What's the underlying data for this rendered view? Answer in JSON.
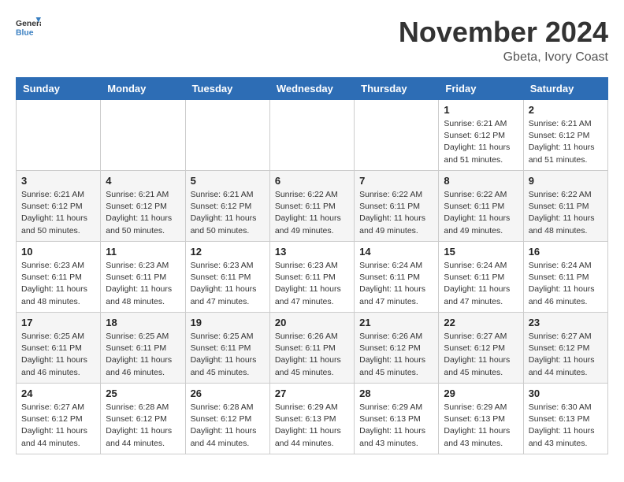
{
  "header": {
    "logo_general": "General",
    "logo_blue": "Blue",
    "month_title": "November 2024",
    "location": "Gbeta, Ivory Coast"
  },
  "days_of_week": [
    "Sunday",
    "Monday",
    "Tuesday",
    "Wednesday",
    "Thursday",
    "Friday",
    "Saturday"
  ],
  "weeks": [
    [
      {
        "day": "",
        "info": ""
      },
      {
        "day": "",
        "info": ""
      },
      {
        "day": "",
        "info": ""
      },
      {
        "day": "",
        "info": ""
      },
      {
        "day": "",
        "info": ""
      },
      {
        "day": "1",
        "info": "Sunrise: 6:21 AM\nSunset: 6:12 PM\nDaylight: 11 hours\nand 51 minutes."
      },
      {
        "day": "2",
        "info": "Sunrise: 6:21 AM\nSunset: 6:12 PM\nDaylight: 11 hours\nand 51 minutes."
      }
    ],
    [
      {
        "day": "3",
        "info": "Sunrise: 6:21 AM\nSunset: 6:12 PM\nDaylight: 11 hours\nand 50 minutes."
      },
      {
        "day": "4",
        "info": "Sunrise: 6:21 AM\nSunset: 6:12 PM\nDaylight: 11 hours\nand 50 minutes."
      },
      {
        "day": "5",
        "info": "Sunrise: 6:21 AM\nSunset: 6:12 PM\nDaylight: 11 hours\nand 50 minutes."
      },
      {
        "day": "6",
        "info": "Sunrise: 6:22 AM\nSunset: 6:11 PM\nDaylight: 11 hours\nand 49 minutes."
      },
      {
        "day": "7",
        "info": "Sunrise: 6:22 AM\nSunset: 6:11 PM\nDaylight: 11 hours\nand 49 minutes."
      },
      {
        "day": "8",
        "info": "Sunrise: 6:22 AM\nSunset: 6:11 PM\nDaylight: 11 hours\nand 49 minutes."
      },
      {
        "day": "9",
        "info": "Sunrise: 6:22 AM\nSunset: 6:11 PM\nDaylight: 11 hours\nand 48 minutes."
      }
    ],
    [
      {
        "day": "10",
        "info": "Sunrise: 6:23 AM\nSunset: 6:11 PM\nDaylight: 11 hours\nand 48 minutes."
      },
      {
        "day": "11",
        "info": "Sunrise: 6:23 AM\nSunset: 6:11 PM\nDaylight: 11 hours\nand 48 minutes."
      },
      {
        "day": "12",
        "info": "Sunrise: 6:23 AM\nSunset: 6:11 PM\nDaylight: 11 hours\nand 47 minutes."
      },
      {
        "day": "13",
        "info": "Sunrise: 6:23 AM\nSunset: 6:11 PM\nDaylight: 11 hours\nand 47 minutes."
      },
      {
        "day": "14",
        "info": "Sunrise: 6:24 AM\nSunset: 6:11 PM\nDaylight: 11 hours\nand 47 minutes."
      },
      {
        "day": "15",
        "info": "Sunrise: 6:24 AM\nSunset: 6:11 PM\nDaylight: 11 hours\nand 47 minutes."
      },
      {
        "day": "16",
        "info": "Sunrise: 6:24 AM\nSunset: 6:11 PM\nDaylight: 11 hours\nand 46 minutes."
      }
    ],
    [
      {
        "day": "17",
        "info": "Sunrise: 6:25 AM\nSunset: 6:11 PM\nDaylight: 11 hours\nand 46 minutes."
      },
      {
        "day": "18",
        "info": "Sunrise: 6:25 AM\nSunset: 6:11 PM\nDaylight: 11 hours\nand 46 minutes."
      },
      {
        "day": "19",
        "info": "Sunrise: 6:25 AM\nSunset: 6:11 PM\nDaylight: 11 hours\nand 45 minutes."
      },
      {
        "day": "20",
        "info": "Sunrise: 6:26 AM\nSunset: 6:11 PM\nDaylight: 11 hours\nand 45 minutes."
      },
      {
        "day": "21",
        "info": "Sunrise: 6:26 AM\nSunset: 6:12 PM\nDaylight: 11 hours\nand 45 minutes."
      },
      {
        "day": "22",
        "info": "Sunrise: 6:27 AM\nSunset: 6:12 PM\nDaylight: 11 hours\nand 45 minutes."
      },
      {
        "day": "23",
        "info": "Sunrise: 6:27 AM\nSunset: 6:12 PM\nDaylight: 11 hours\nand 44 minutes."
      }
    ],
    [
      {
        "day": "24",
        "info": "Sunrise: 6:27 AM\nSunset: 6:12 PM\nDaylight: 11 hours\nand 44 minutes."
      },
      {
        "day": "25",
        "info": "Sunrise: 6:28 AM\nSunset: 6:12 PM\nDaylight: 11 hours\nand 44 minutes."
      },
      {
        "day": "26",
        "info": "Sunrise: 6:28 AM\nSunset: 6:12 PM\nDaylight: 11 hours\nand 44 minutes."
      },
      {
        "day": "27",
        "info": "Sunrise: 6:29 AM\nSunset: 6:13 PM\nDaylight: 11 hours\nand 44 minutes."
      },
      {
        "day": "28",
        "info": "Sunrise: 6:29 AM\nSunset: 6:13 PM\nDaylight: 11 hours\nand 43 minutes."
      },
      {
        "day": "29",
        "info": "Sunrise: 6:29 AM\nSunset: 6:13 PM\nDaylight: 11 hours\nand 43 minutes."
      },
      {
        "day": "30",
        "info": "Sunrise: 6:30 AM\nSunset: 6:13 PM\nDaylight: 11 hours\nand 43 minutes."
      }
    ]
  ]
}
